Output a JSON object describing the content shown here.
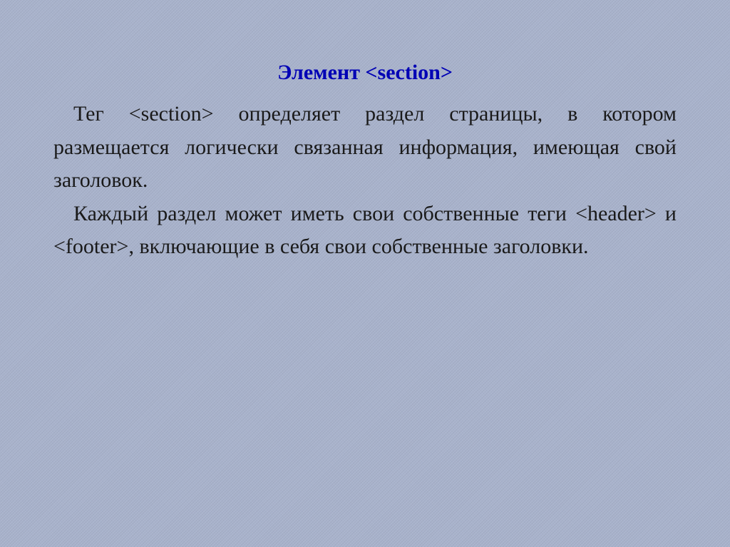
{
  "title": "Элемент <section>",
  "paragraph1": "Тег <section> определяет раздел страницы, в котором размещается логически связанная информация, имеющая свой заголовок.",
  "paragraph2": "Каждый раздел может иметь свои собственные теги <header> и <footer>, включающие в себя свои собственные заголовки."
}
